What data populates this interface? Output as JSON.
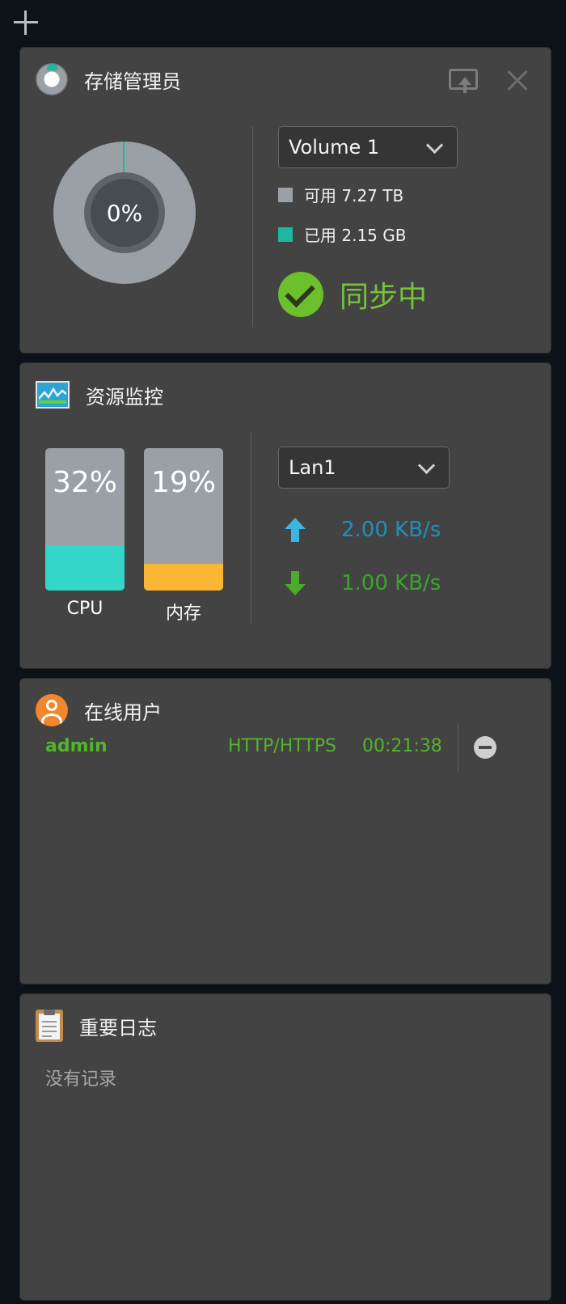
{
  "storage": {
    "title": "存储管理员",
    "usage_percent_label": "0%",
    "used_fraction": 0.0003,
    "volume_selected": "Volume 1",
    "available_label": "可用 7.27 TB",
    "used_label": "已用 2.15 GB",
    "status": "同步中",
    "colors": {
      "available": "#9aa0a6",
      "used": "#1fb89e",
      "status": "#76c33a"
    }
  },
  "resource": {
    "title": "资源监控",
    "cpu": {
      "label": "CPU",
      "percent_label": "32%",
      "percent": 32,
      "color": "#33d6c8"
    },
    "memory": {
      "label": "内存",
      "percent_label": "19%",
      "percent": 19,
      "color": "#fbb734"
    },
    "interface_selected": "Lan1",
    "upload": "2.00 KB/s",
    "download": "1.00 KB/s",
    "colors": {
      "upload": "#1f8fbf",
      "download": "#3aa52a"
    }
  },
  "users": {
    "title": "在线用户",
    "rows": [
      {
        "name": "admin",
        "protocol": "HTTP/HTTPS",
        "duration": "00:21:38"
      }
    ]
  },
  "logs": {
    "title": "重要日志",
    "empty": "没有记录"
  }
}
